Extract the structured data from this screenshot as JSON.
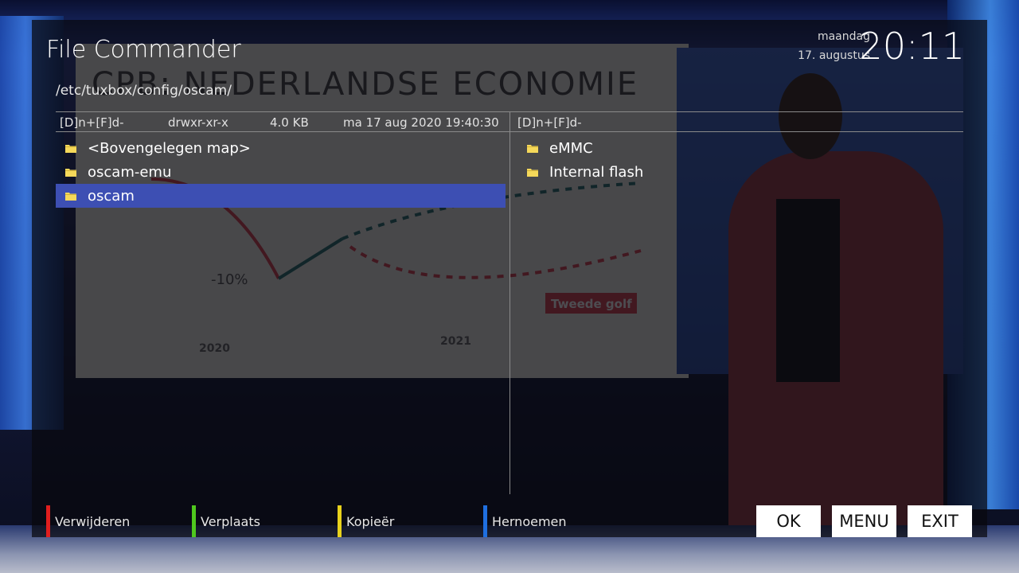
{
  "header": {
    "title": "File Commander",
    "weekday": "maandag",
    "date": "17. augustus",
    "time": "20:11"
  },
  "path": "/etc/tuxbox/config/oscam/",
  "info": {
    "left_mode": "[D]n+[F]d-",
    "permissions": "drwxr-xr-x",
    "size": "4.0 KB",
    "modified": "ma 17 aug 2020 19:40:30",
    "right_mode": "[D]n+[F]d-"
  },
  "left_list": [
    {
      "label": "<Bovengelegen map>",
      "icon": "folder-icon",
      "selected": false
    },
    {
      "label": "oscam-emu",
      "icon": "folder-icon",
      "selected": false
    },
    {
      "label": "oscam",
      "icon": "folder-icon",
      "selected": true
    }
  ],
  "right_list": [
    {
      "label": "eMMC",
      "icon": "folder-icon",
      "selected": false
    },
    {
      "label": "Internal flash",
      "icon": "folder-icon",
      "selected": false
    }
  ],
  "keys": {
    "red": {
      "label": "Verwijderen",
      "color": "#e01e1e"
    },
    "green": {
      "label": "Verplaats",
      "color": "#4fc81e"
    },
    "yellow": {
      "label": "Kopieër",
      "color": "#e8d21c"
    },
    "blue": {
      "label": "Hernoemen",
      "color": "#1f6fe0"
    }
  },
  "buttons": {
    "ok": "OK",
    "menu": "MENU",
    "exit": "EXIT"
  },
  "colors": {
    "selection": "#3d4fb3",
    "folder": "#f5d85a"
  }
}
